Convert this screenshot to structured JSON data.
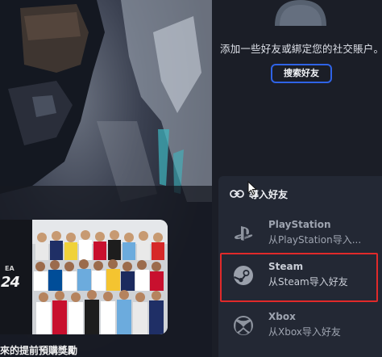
{
  "hero": {
    "promo_logo_brand": "EA",
    "promo_logo_number": "24",
    "promo_caption": "來的提前預購獎勵"
  },
  "friends": {
    "prompt": "添加一些好友或綁定您的社交賬户。",
    "search_button": "搜索好友"
  },
  "import": {
    "header": "導入好友",
    "header_icon": "link-icon",
    "platforms": [
      {
        "name": "PlayStation",
        "subtitle": "从PlayStation导入...",
        "icon": "playstation-icon"
      },
      {
        "name": "Steam",
        "subtitle": "从Steam导入好友",
        "icon": "steam-icon"
      },
      {
        "name": "Xbox",
        "subtitle": "从Xbox导入好友",
        "icon": "xbox-icon"
      }
    ]
  },
  "colors": {
    "background": "#1b1e27",
    "panel": "#232834",
    "accent_blue": "#2f63e6",
    "highlight_red": "#e02a2a"
  }
}
